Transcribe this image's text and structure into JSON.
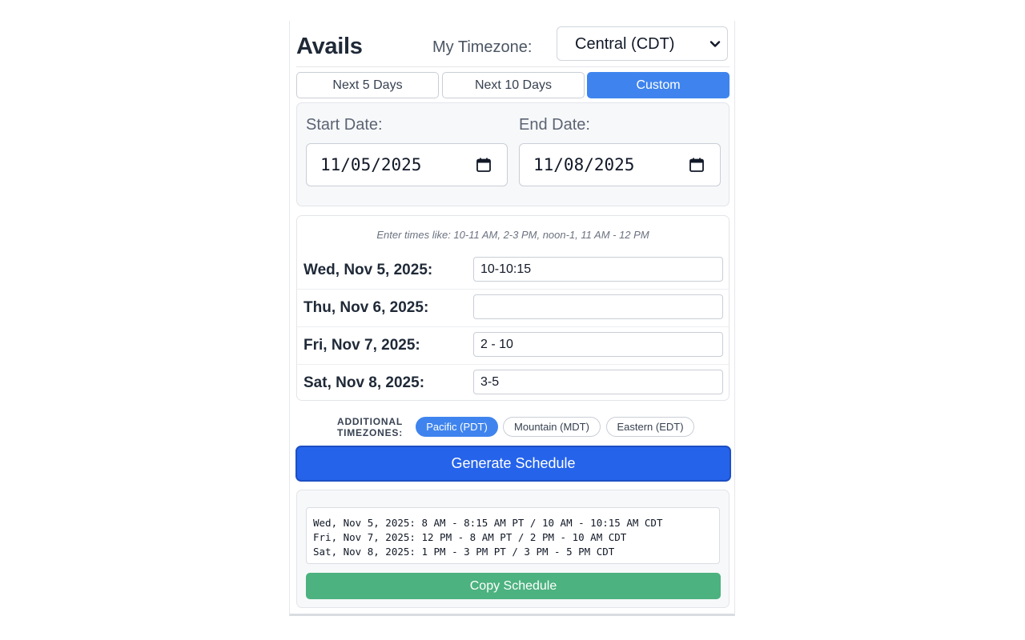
{
  "header": {
    "title": "Avails",
    "timezone_label": "My Timezone:",
    "timezone_value": "Central (CDT)"
  },
  "range_tabs": [
    {
      "label": "Next 5 Days",
      "active": false
    },
    {
      "label": "Next 10 Days",
      "active": false
    },
    {
      "label": "Custom",
      "active": true
    }
  ],
  "dates": {
    "start_label": "Start Date:",
    "start_value": "11/05/2025",
    "end_label": "End Date:",
    "end_value": "11/08/2025"
  },
  "times": {
    "hint": "Enter times like: 10-11 AM, 2-3 PM, noon-1, 11 AM - 12 PM",
    "days": [
      {
        "label": "Wed, Nov 5, 2025:",
        "value": "10-10:15"
      },
      {
        "label": "Thu, Nov 6, 2025:",
        "value": ""
      },
      {
        "label": "Fri, Nov 7, 2025:",
        "value": "2 - 10"
      },
      {
        "label": "Sat, Nov 8, 2025:",
        "value": "3-5"
      }
    ]
  },
  "additional_timezones": {
    "label_line1": "ADDITIONAL",
    "label_line2": "TIMEZONES:",
    "chips": [
      {
        "label": "Pacific (PDT)",
        "active": true
      },
      {
        "label": "Mountain (MDT)",
        "active": false
      },
      {
        "label": "Eastern (EDT)",
        "active": false
      }
    ]
  },
  "generate_button": "Generate Schedule",
  "output": {
    "lines": [
      "Wed, Nov 5, 2025: 8 AM - 8:15 AM PT / 10 AM - 10:15 AM CDT",
      "Fri, Nov 7, 2025: 12 PM - 8 AM PT / 2 PM - 10 AM CDT",
      "Sat, Nov 8, 2025: 1 PM - 3 PM PT / 3 PM - 5 PM CDT"
    ],
    "copy_button": "Copy Schedule"
  },
  "colors": {
    "accent": "#3f84ee",
    "primary_button": "#2563eb",
    "copy_button": "#4cb27f"
  },
  "icons": {
    "timezone_dropdown": "chevron-down-icon",
    "date_picker": "calendar-icon"
  }
}
